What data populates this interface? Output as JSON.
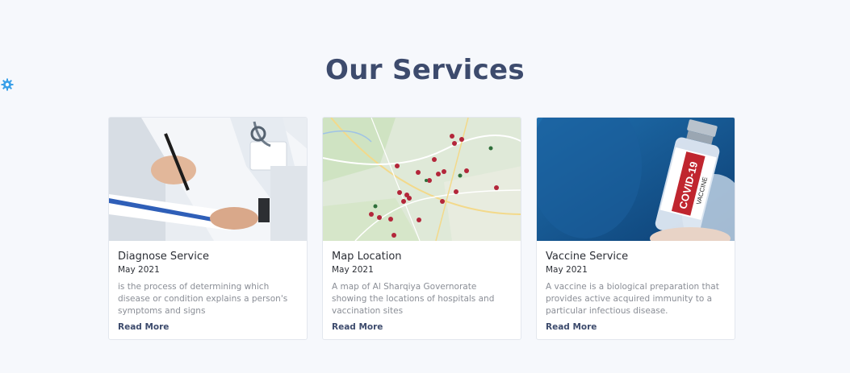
{
  "header": {
    "title": "Our Services"
  },
  "settings": {
    "icon": "gear-icon",
    "color": "#3aa0e8"
  },
  "cards": [
    {
      "image": "doctor-writing-image",
      "title": "Diagnose Service",
      "date": "May 2021",
      "description": "is the process of determining which disease or condition explains a person's symptoms and signs",
      "link": "Read More"
    },
    {
      "image": "map-image",
      "title": "Map Location",
      "date": "May 2021",
      "description": "A map of Al Sharqiya Governorate showing the locations of hospitals and vaccination sites",
      "link": "Read More"
    },
    {
      "image": "vaccine-vial-image",
      "title": "Vaccine Service",
      "date": "May 2021",
      "description": "A vaccine is a biological preparation that provides active acquired immunity to a particular infectious disease.",
      "link": "Read More",
      "image_text": "COVID-19 VACCINE"
    }
  ],
  "colors": {
    "title": "#3d4b6d",
    "background": "#f6f8fc"
  }
}
